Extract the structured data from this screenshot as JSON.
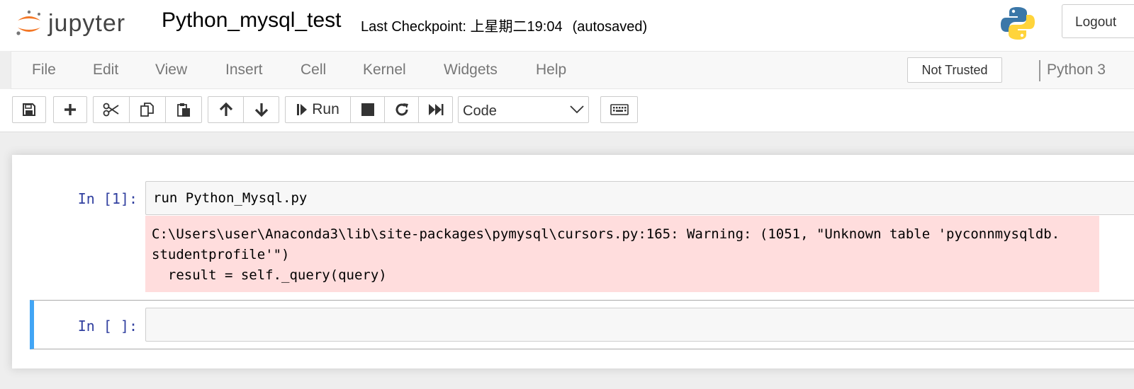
{
  "header": {
    "logo_text": "jupyter",
    "notebook_name": "Python_mysql_test",
    "checkpoint_text": "Last Checkpoint: 上星期二19:04",
    "autosave_text": "(autosaved)",
    "logout_label": "Logout"
  },
  "menubar": {
    "items": [
      "File",
      "Edit",
      "View",
      "Insert",
      "Cell",
      "Kernel",
      "Widgets",
      "Help"
    ],
    "trust_label": "Not Trusted",
    "kernel_name": "Python 3"
  },
  "toolbar": {
    "run_label": "Run",
    "cell_type": "Code",
    "icons": [
      "save-icon",
      "plus-icon",
      "scissors-icon",
      "copy-icon",
      "paste-icon",
      "arrow-up-icon",
      "arrow-down-icon",
      "step-forward-icon",
      "stop-icon",
      "restart-icon",
      "fast-forward-icon",
      "keyboard-icon"
    ]
  },
  "cells": [
    {
      "prompt": "In [1]:",
      "source": "run Python_Mysql.py",
      "output": "C:\\Users\\user\\Anaconda3\\lib\\site-packages\\pymysql\\cursors.py:165: Warning: (1051, \"Unknown table 'pyconnmysqldb.\nstudentprofile'\")\n  result = self._query(query)"
    },
    {
      "prompt": "In [ ]:",
      "source": ""
    }
  ]
}
